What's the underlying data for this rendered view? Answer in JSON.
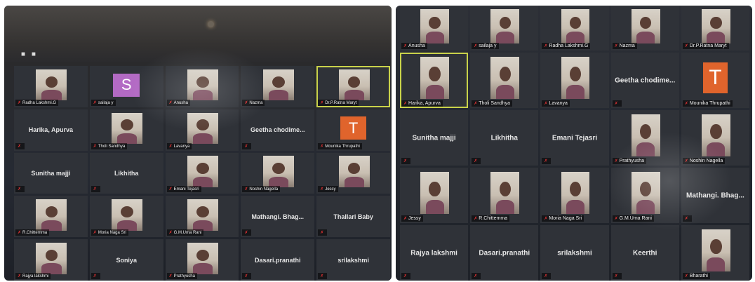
{
  "left_screen": {
    "tiles": [
      {
        "kind": "video",
        "name": "Radha Lakshmi.G"
      },
      {
        "kind": "avatar",
        "avatar_letter": "S",
        "avatar_color": "#b36ac4",
        "name": "sailaja y"
      },
      {
        "kind": "video",
        "name": "Anusha"
      },
      {
        "kind": "video",
        "name": "Nazma"
      },
      {
        "kind": "video",
        "name": "Dr.P.Ratna Maryt",
        "active": true
      },
      {
        "kind": "text",
        "center": "Harika, Apurva",
        "name": ""
      },
      {
        "kind": "video",
        "name": "Tholi Sandhya"
      },
      {
        "kind": "video",
        "name": "Lavanya"
      },
      {
        "kind": "text",
        "center": "Geetha chodime...",
        "name": ""
      },
      {
        "kind": "avatar",
        "avatar_letter": "T",
        "avatar_color": "#e0642c",
        "name": "Mounika Thrupathi"
      },
      {
        "kind": "text",
        "center": "Sunitha majji",
        "name": ""
      },
      {
        "kind": "text",
        "center": "Likhitha",
        "name": ""
      },
      {
        "kind": "video",
        "name": "Emani Tejasri"
      },
      {
        "kind": "video",
        "name": "Noshin Nagella"
      },
      {
        "kind": "video",
        "name": "Jessy"
      },
      {
        "kind": "video",
        "name": "R.Chittemma"
      },
      {
        "kind": "video",
        "name": "Moria Naga Sri"
      },
      {
        "kind": "video",
        "name": "G.M.Uma Rani"
      },
      {
        "kind": "text",
        "center": "Mathangi. Bhag...",
        "name": ""
      },
      {
        "kind": "text",
        "center": "Thallari Baby",
        "name": ""
      },
      {
        "kind": "video",
        "name": "Rajya lakshmi"
      },
      {
        "kind": "text",
        "center": "Soniya",
        "name": ""
      },
      {
        "kind": "video",
        "name": "Prathyusha"
      },
      {
        "kind": "text",
        "center": "Dasari.pranathi",
        "name": ""
      },
      {
        "kind": "text",
        "center": "srilakshmi",
        "name": ""
      }
    ]
  },
  "right_screen": {
    "tiles": [
      {
        "kind": "video",
        "name": "Anusha"
      },
      {
        "kind": "video",
        "name": "sailaja y"
      },
      {
        "kind": "video",
        "name": "Radha Lakshmi.G"
      },
      {
        "kind": "video",
        "name": "Nazma"
      },
      {
        "kind": "video",
        "name": "Dr.P.Ratna Maryt"
      },
      {
        "kind": "video",
        "name": "Harika, Apurva",
        "active": true
      },
      {
        "kind": "video",
        "name": "Tholi Sandhya"
      },
      {
        "kind": "video",
        "name": "Lavanya"
      },
      {
        "kind": "text",
        "center": "Geetha chodime...",
        "name": ""
      },
      {
        "kind": "avatar",
        "avatar_letter": "T",
        "avatar_color": "#e0642c",
        "name": "Mounika Thrupathi"
      },
      {
        "kind": "text",
        "center": "Sunitha majji",
        "name": ""
      },
      {
        "kind": "text",
        "center": "Likhitha",
        "name": ""
      },
      {
        "kind": "text",
        "center": "Emani Tejasri",
        "name": ""
      },
      {
        "kind": "video",
        "name": "Prathyusha"
      },
      {
        "kind": "video",
        "name": "Noshin Nagella"
      },
      {
        "kind": "video",
        "name": "Jessy"
      },
      {
        "kind": "video",
        "name": "R.Chittemma"
      },
      {
        "kind": "video",
        "name": "Moria Naga Sri"
      },
      {
        "kind": "video",
        "name": "G.M.Uma Rani"
      },
      {
        "kind": "text",
        "center": "Mathangi. Bhag...",
        "name": ""
      },
      {
        "kind": "text",
        "center": "Rajya lakshmi",
        "name": ""
      },
      {
        "kind": "text",
        "center": "Dasari.pranathi",
        "name": ""
      },
      {
        "kind": "text",
        "center": "srilakshmi",
        "name": ""
      },
      {
        "kind": "text",
        "center": "Keerthi",
        "name": ""
      },
      {
        "kind": "video",
        "name": "Bharathi"
      }
    ]
  }
}
